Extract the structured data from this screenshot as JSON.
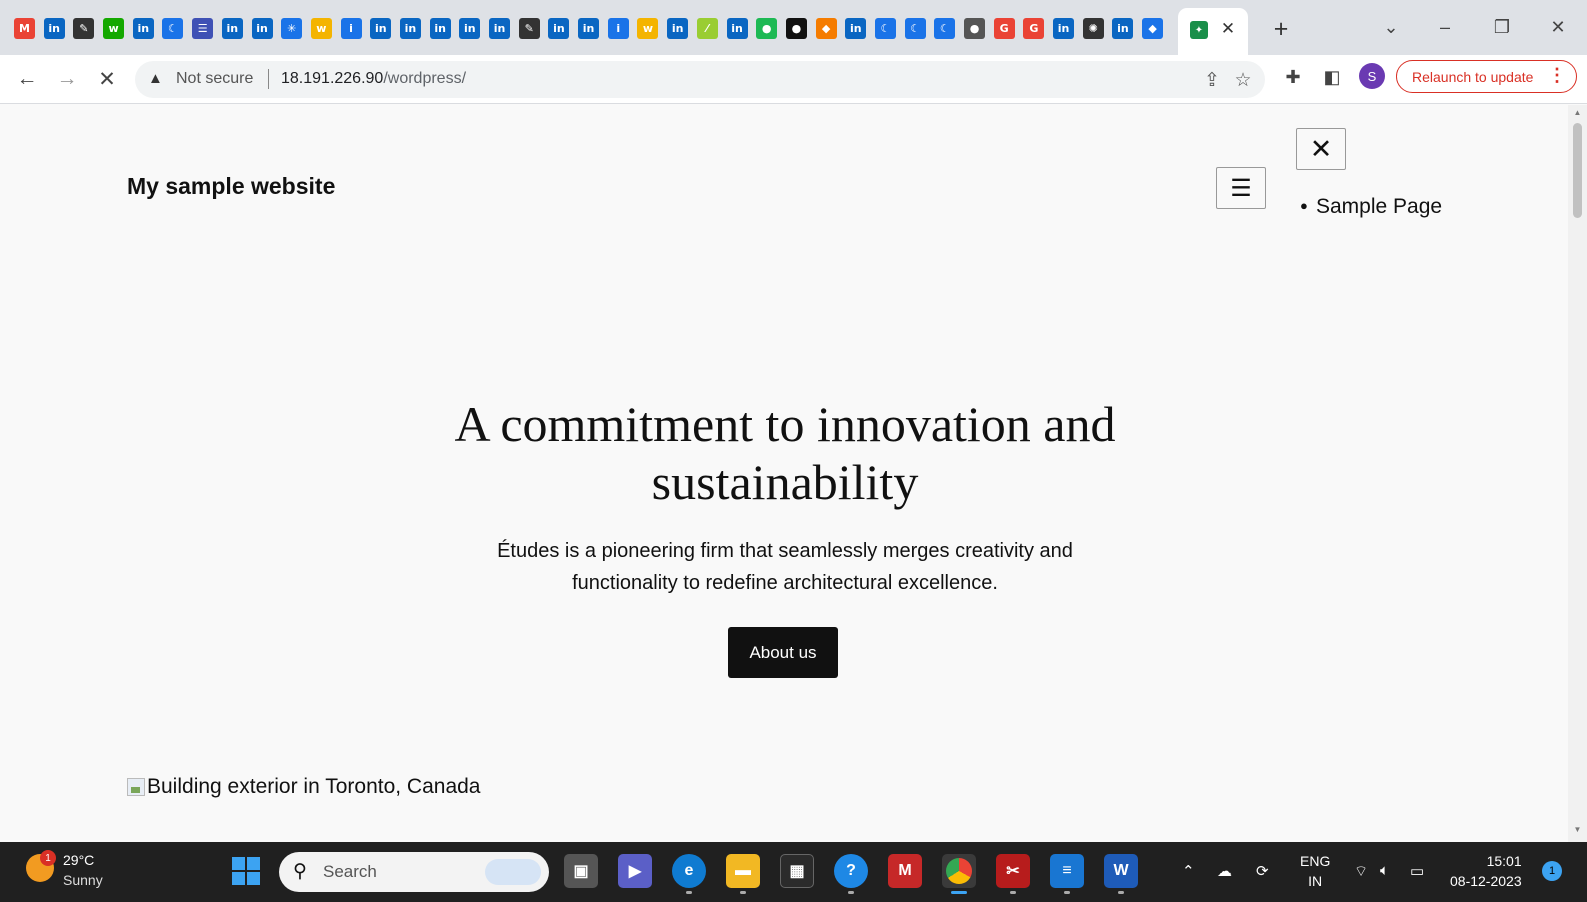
{
  "browser": {
    "tab_favicons": [
      {
        "icon": "gmail-icon",
        "glyph": "M",
        "color": "#ea4335"
      },
      {
        "icon": "linkedin-icon",
        "glyph": "in",
        "color": "#0a66c2"
      },
      {
        "icon": "edit-icon",
        "glyph": "✎",
        "color": "#333333"
      },
      {
        "icon": "upwork-icon",
        "glyph": "w",
        "color": "#14a800"
      },
      {
        "icon": "linkedin-icon",
        "glyph": "in",
        "color": "#0a66c2"
      },
      {
        "icon": "moon-icon",
        "glyph": "☾",
        "color": "#1a73e8"
      },
      {
        "icon": "list-icon",
        "glyph": "☰",
        "color": "#3f51b5"
      },
      {
        "icon": "linkedin-icon",
        "glyph": "in",
        "color": "#0a66c2"
      },
      {
        "icon": "linkedin-icon",
        "glyph": "in",
        "color": "#0a66c2"
      },
      {
        "icon": "spark-icon",
        "glyph": "✳",
        "color": "#1a73e8"
      },
      {
        "icon": "wifi-w-icon",
        "glyph": "w",
        "color": "#f4b400"
      },
      {
        "icon": "info-icon",
        "glyph": "i",
        "color": "#1a73e8"
      },
      {
        "icon": "linkedin-icon",
        "glyph": "in",
        "color": "#0a66c2"
      },
      {
        "icon": "linkedin-icon",
        "glyph": "in",
        "color": "#0a66c2"
      },
      {
        "icon": "linkedin-icon",
        "glyph": "in",
        "color": "#0a66c2"
      },
      {
        "icon": "linkedin-icon",
        "glyph": "in",
        "color": "#0a66c2"
      },
      {
        "icon": "linkedin-icon",
        "glyph": "in",
        "color": "#0a66c2"
      },
      {
        "icon": "edit-icon",
        "glyph": "✎",
        "color": "#333333"
      },
      {
        "icon": "linkedin-icon",
        "glyph": "in",
        "color": "#0a66c2"
      },
      {
        "icon": "linkedin-icon",
        "glyph": "in",
        "color": "#0a66c2"
      },
      {
        "icon": "info-icon",
        "glyph": "i",
        "color": "#1a73e8"
      },
      {
        "icon": "wifi-w-icon",
        "glyph": "w",
        "color": "#f4b400"
      },
      {
        "icon": "linkedin-icon",
        "glyph": "in",
        "color": "#0a66c2"
      },
      {
        "icon": "chart-icon",
        "glyph": "⁄",
        "color": "#9acd32"
      },
      {
        "icon": "linkedin-icon",
        "glyph": "in",
        "color": "#0a66c2"
      },
      {
        "icon": "spotify-icon",
        "glyph": "●",
        "color": "#1db954"
      },
      {
        "icon": "github-icon",
        "glyph": "●",
        "color": "#111111"
      },
      {
        "icon": "orange-app-icon",
        "glyph": "◆",
        "color": "#f57c00"
      },
      {
        "icon": "linkedin-icon",
        "glyph": "in",
        "color": "#0a66c2"
      },
      {
        "icon": "moon-icon",
        "glyph": "☾",
        "color": "#1a73e8"
      },
      {
        "icon": "moon-icon",
        "glyph": "☾",
        "color": "#1a73e8"
      },
      {
        "icon": "moon-icon",
        "glyph": "☾",
        "color": "#1a73e8"
      },
      {
        "icon": "globe-icon",
        "glyph": "●",
        "color": "#555555"
      },
      {
        "icon": "google-icon",
        "glyph": "G",
        "color": "#ea4335"
      },
      {
        "icon": "google-icon",
        "glyph": "G",
        "color": "#ea4335"
      },
      {
        "icon": "linkedin-icon",
        "glyph": "in",
        "color": "#0a66c2"
      },
      {
        "icon": "chatgpt-icon",
        "glyph": "✺",
        "color": "#333333"
      },
      {
        "icon": "linkedin-icon",
        "glyph": "in",
        "color": "#0a66c2"
      },
      {
        "icon": "blue-app-icon",
        "glyph": "◆",
        "color": "#1a73e8"
      }
    ],
    "address": {
      "security_label": "Not secure",
      "host": "18.191.226.90",
      "path": "/wordpress/"
    },
    "relaunch_label": "Relaunch to update",
    "profile_initial": "S"
  },
  "site": {
    "title": "My sample website",
    "nav_items": [
      "Sample Page"
    ],
    "hero_title": "A commitment to innovation and sustainability",
    "hero_description": "Études is a pioneering firm that seamlessly merges creativity and functionality to redefine architectural excellence.",
    "cta_label": "About us",
    "image_alt": "Building exterior in Toronto, Canada"
  },
  "taskbar": {
    "weather_badge": "1",
    "temperature": "29°C",
    "condition": "Sunny",
    "search_placeholder": "Search",
    "language_line1": "ENG",
    "language_line2": "IN",
    "time": "15:01",
    "date": "08-12-2023",
    "notification_count": "1"
  }
}
